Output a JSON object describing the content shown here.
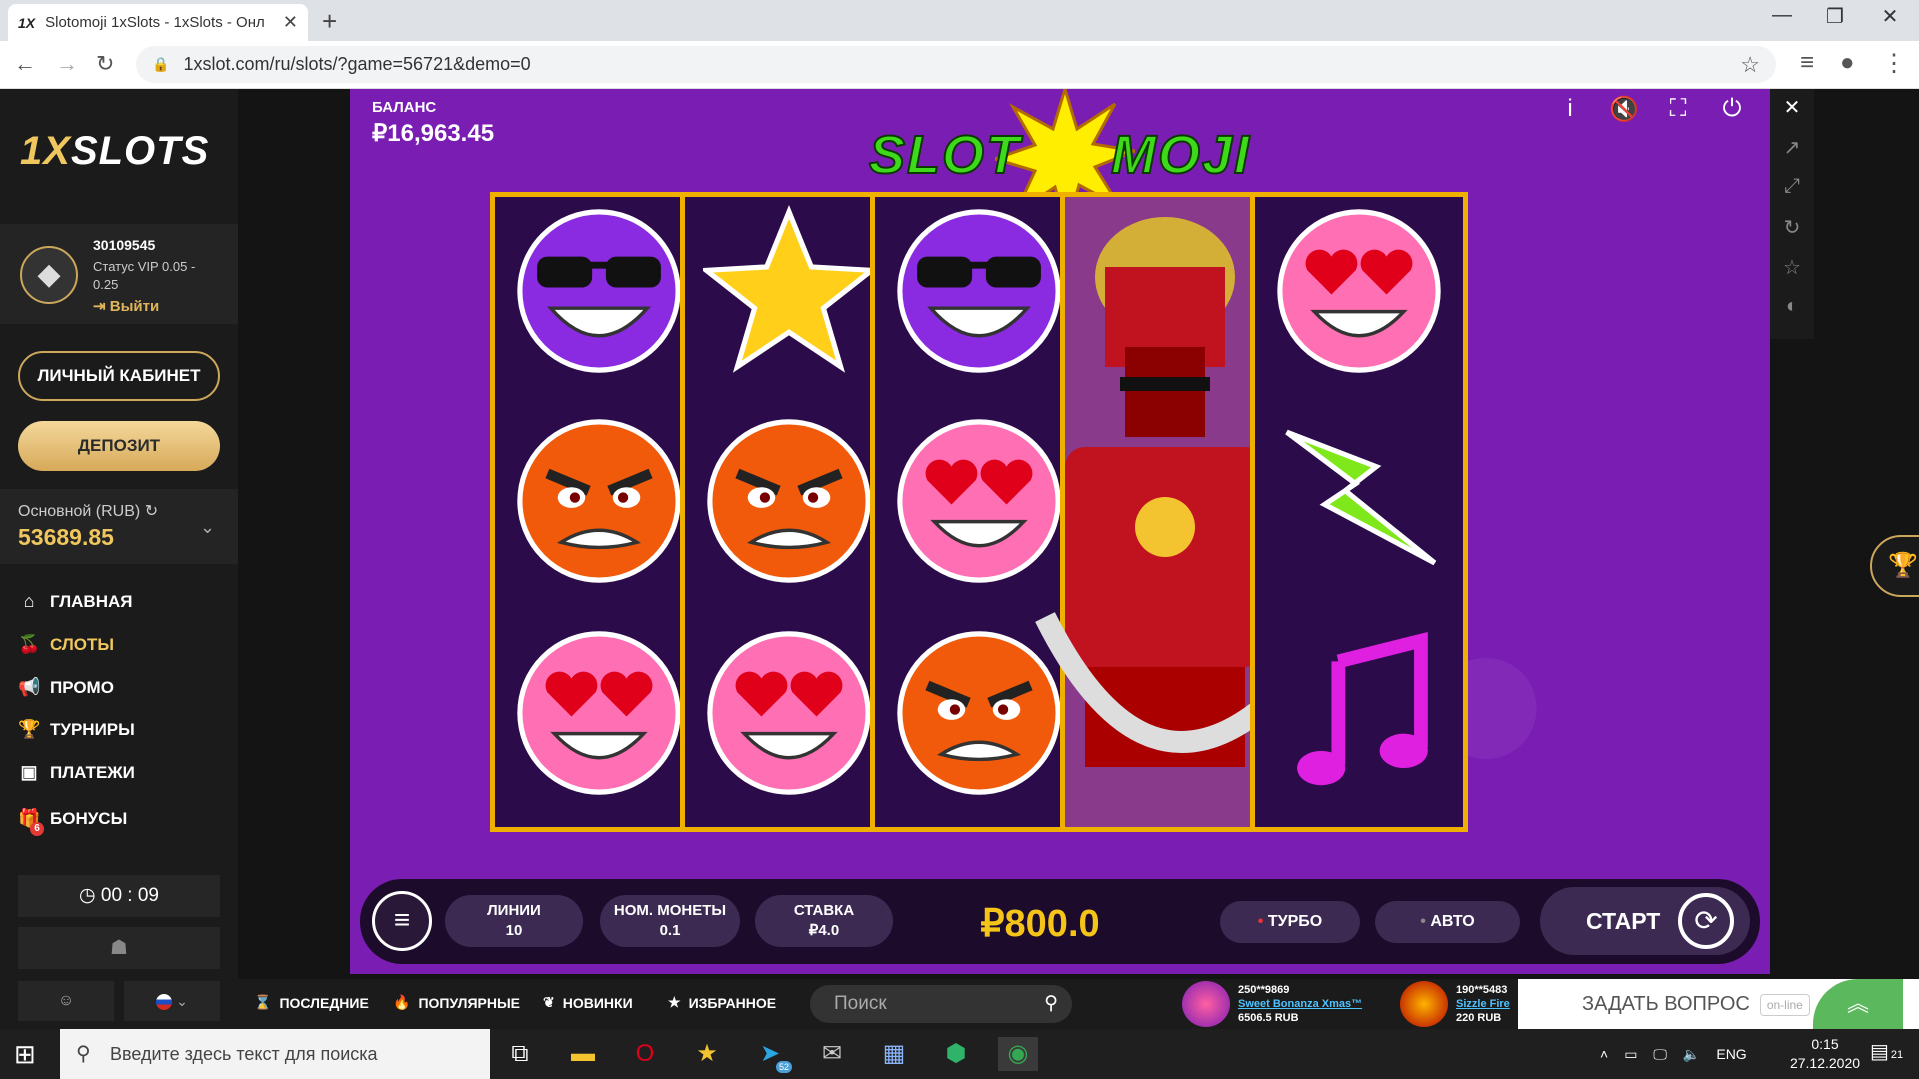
{
  "browser": {
    "tab_title": "Slotomoji 1xSlots - 1xSlots - Онл",
    "tab_favicon": "1X",
    "url": "1xslot.com/ru/slots/?game=56721&demo=0"
  },
  "site": {
    "logo_a": "1X",
    "logo_b": "SLOTS",
    "user": {
      "id": "30109545",
      "vip": "Статус VIP 0.05 - 0.25",
      "logout": "Выйти"
    },
    "cabinet_label": "ЛИЧНЫЙ КАБИНЕТ",
    "deposit_label": "ДЕПОЗИТ",
    "account": {
      "label": "Основной (RUB)",
      "value": "53689.85"
    },
    "nav": [
      {
        "label": "ГЛАВНАЯ",
        "icon": "home-icon"
      },
      {
        "label": "СЛОТЫ",
        "icon": "cherry-icon"
      },
      {
        "label": "ПРОМО",
        "icon": "megaphone-icon"
      },
      {
        "label": "ТУРНИРЫ",
        "icon": "trophy-icon"
      },
      {
        "label": "ПЛАТЕЖИ",
        "icon": "wallet-icon"
      },
      {
        "label": "БОНУСЫ",
        "icon": "gift-icon",
        "badge": "6"
      }
    ],
    "timer": "00 : 09"
  },
  "game": {
    "balance_label": "БАЛАНС",
    "balance_value": "₽16,963.45",
    "title_a": "SLOT",
    "title_b": "MOJI",
    "reels": [
      [
        "cool-sunglasses-emoji",
        "angry-emoji",
        "heart-eyes-emoji"
      ],
      [
        "star",
        "angry-emoji",
        "heart-eyes-emoji"
      ],
      [
        "cool-sunglasses-emoji",
        "heart-eyes-emoji",
        "angry-emoji"
      ],
      [
        "samurai-wild"
      ],
      [
        "heart-eyes-emoji",
        "lightning-bolt",
        "music-note"
      ]
    ],
    "lines_label": "ЛИНИИ",
    "lines_value": "10",
    "coin_label": "НОМ. МОНЕТЫ",
    "coin_value": "0.1",
    "bet_label": "СТАВКА",
    "bet_value": "₽4.0",
    "win": "₽800.0",
    "turbo": "ТУРБО",
    "auto": "АВТО",
    "start": "СТАРТ"
  },
  "bottom": {
    "tabs": [
      "ПОСЛЕДНИЕ",
      "ПОПУЛЯРНЫЕ",
      "НОВИНКИ",
      "ИЗБРАННОЕ"
    ],
    "search_placeholder": "Поиск",
    "feed": [
      {
        "user": "250**9869",
        "game": "Sweet Bonanza Xmas™",
        "amount": "6506.5 RUB"
      },
      {
        "user": "190**5483",
        "game": "Sizzle Fire",
        "amount": "220 RUB"
      }
    ],
    "ask": "ЗАДАТЬ ВОПРОС",
    "online": "on-line"
  },
  "taskbar": {
    "search": "Введите здесь текст для поиска",
    "lang": "ENG",
    "time": "0:15",
    "date": "27.12.2020",
    "notif_count": "21",
    "telegram_badge": "52"
  },
  "colors": {
    "accent_gold": "#f0c75e",
    "game_purple": "#7a1db3",
    "reel_border": "#f0b000"
  }
}
